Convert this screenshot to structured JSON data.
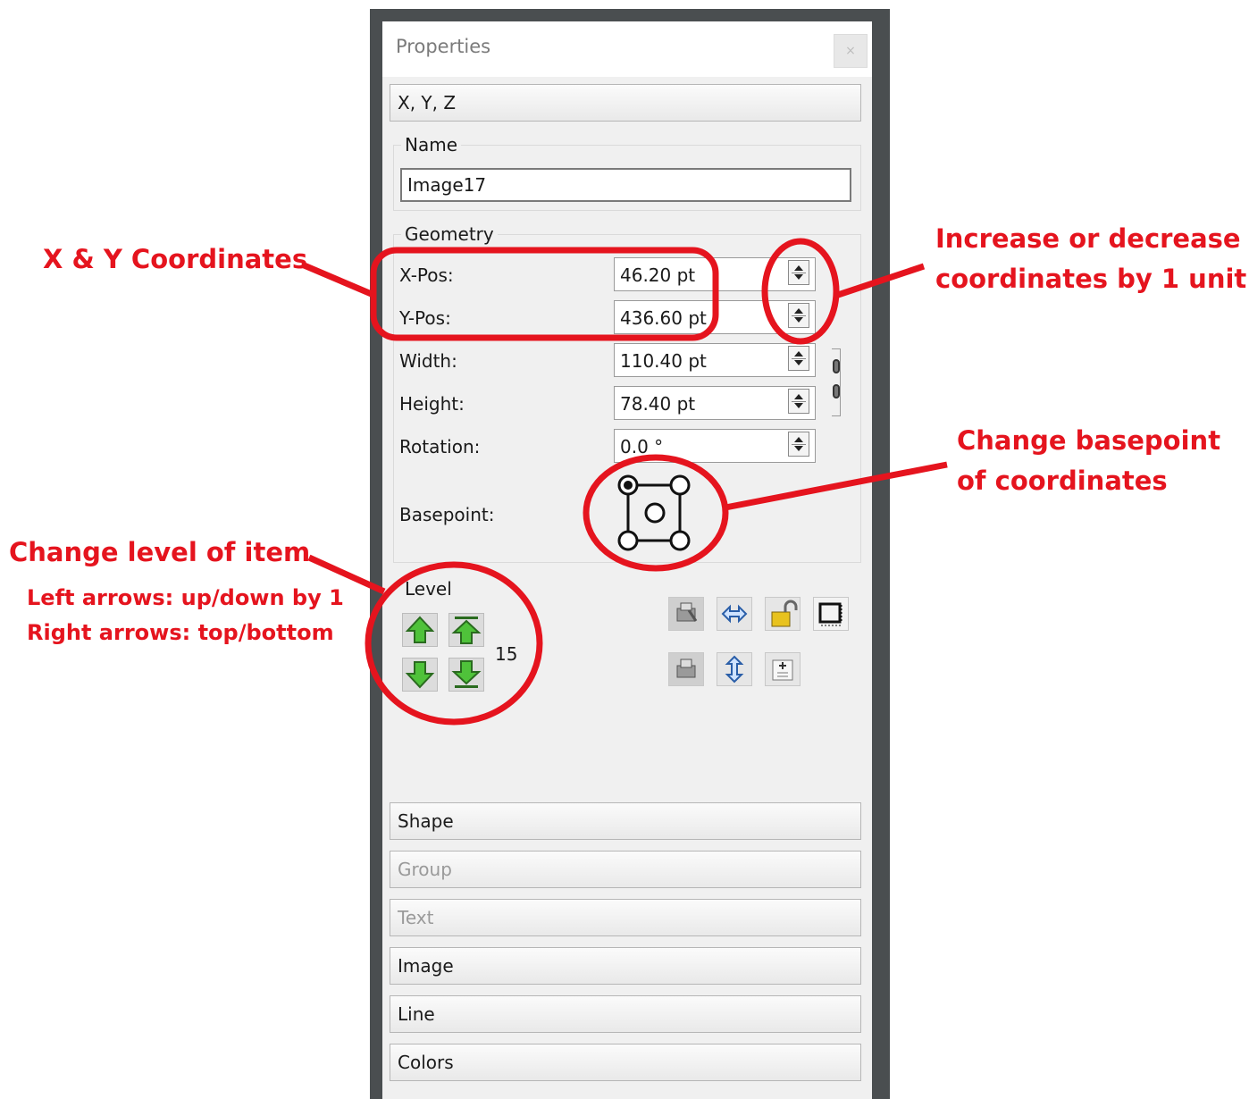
{
  "panel": {
    "title": "Properties",
    "close_glyph": "×",
    "tab_xyz": "X, Y, Z",
    "name_group": {
      "label": "Name",
      "value": "Image17"
    },
    "geometry": {
      "label": "Geometry",
      "x_pos": {
        "label": "X-Pos:",
        "value": "46.20 pt"
      },
      "y_pos": {
        "label": "Y-Pos:",
        "value": "436.60 pt"
      },
      "width": {
        "label": "Width:",
        "value": "110.40 pt"
      },
      "height": {
        "label": "Height:",
        "value": "78.40 pt"
      },
      "rotation": {
        "label": "Rotation:",
        "value": "0.0 °"
      },
      "basepoint_label": "Basepoint:"
    },
    "level": {
      "label": "Level",
      "value": "15"
    },
    "sections": [
      {
        "label": "Shape",
        "enabled": true
      },
      {
        "label": "Group",
        "enabled": false
      },
      {
        "label": "Text",
        "enabled": false
      },
      {
        "label": "Image",
        "enabled": true
      },
      {
        "label": "Line",
        "enabled": true
      },
      {
        "label": "Colors",
        "enabled": true
      }
    ]
  },
  "annotations": {
    "xy": "X & Y Coordinates",
    "increase_line1": "Increase or decrease",
    "increase_line2": "coordinates by 1 unit",
    "basepoint_line1": "Change basepoint",
    "basepoint_line2": "of coordinates",
    "level_title": "Change level of item",
    "level_line1": "Left arrows: up/down by 1",
    "level_line2": "Right arrows: top/bottom",
    "color": "#e5141e"
  }
}
